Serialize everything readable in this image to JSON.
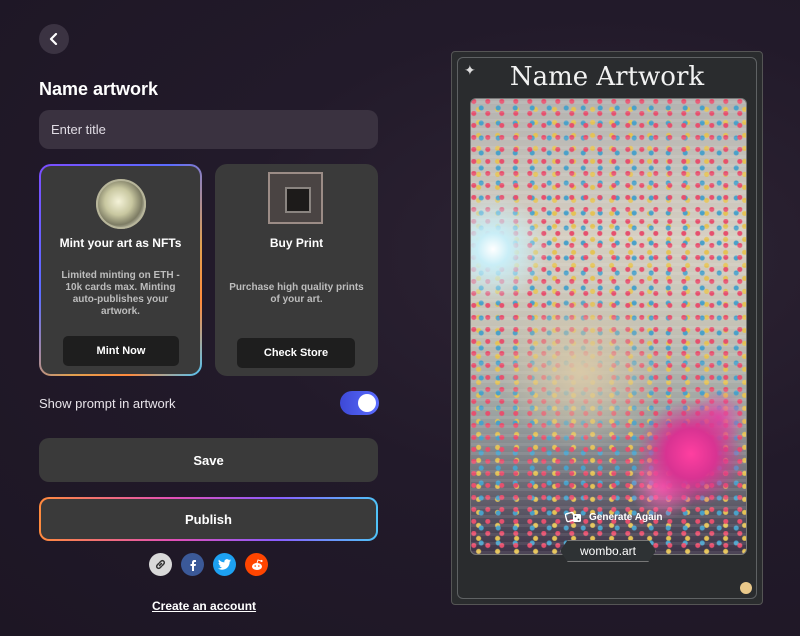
{
  "header": {
    "title": "Name artwork"
  },
  "title_input": {
    "placeholder": "Enter title",
    "value": ""
  },
  "nft_card": {
    "heading": "Mint your art as NFTs",
    "description": "Limited minting on ETH - 10k cards max. Minting auto-publishes your artwork.",
    "button_label": "Mint Now"
  },
  "print_card": {
    "heading": "Buy Print",
    "description": "Purchase high quality prints of your art.",
    "button_label": "Check Store"
  },
  "toggle": {
    "label": "Show prompt in artwork",
    "checked": true
  },
  "actions": {
    "save_label": "Save",
    "publish_label": "Publish"
  },
  "share_icons": [
    "link-icon",
    "facebook-icon",
    "twitter-icon",
    "reddit-icon"
  ],
  "create_account_label": "Create an account",
  "preview": {
    "title": "Name Artwork",
    "generate_again_label": "Generate Again",
    "watermark": "wombo.art"
  },
  "colors": {
    "background": "#221a2a",
    "card": "#3a3a3a",
    "toggle_on": "#4a5be8",
    "facebook": "#3b5998",
    "twitter": "#1da1f2",
    "reddit": "#ff4500"
  }
}
